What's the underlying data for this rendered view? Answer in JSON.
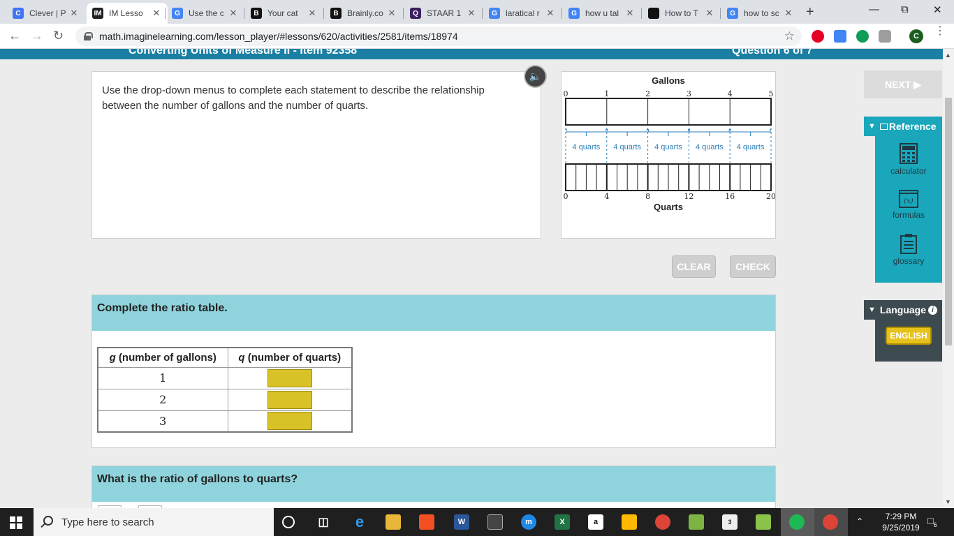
{
  "browser": {
    "tabs": [
      {
        "label": "Clever | P",
        "favicon": "C",
        "color": "#4274f6"
      },
      {
        "label": "IM Lesso",
        "favicon": "IM",
        "color": "#202124"
      },
      {
        "label": "Use the c",
        "favicon": "G",
        "color": "#4285f4"
      },
      {
        "label": "Your cat",
        "favicon": "B",
        "color": "#111111"
      },
      {
        "label": "Brainly.co",
        "favicon": "B",
        "color": "#111111"
      },
      {
        "label": "STAAR 1",
        "favicon": "Q",
        "color": "#3c1f5e"
      },
      {
        "label": "laratical r",
        "favicon": "G",
        "color": "#4285f4"
      },
      {
        "label": "how u tal",
        "favicon": "G",
        "color": "#4285f4"
      },
      {
        "label": "How to T",
        "favicon": "HTG",
        "color": "#111111"
      },
      {
        "label": "how to sc",
        "favicon": "G",
        "color": "#4285f4"
      }
    ],
    "url": "math.imaginelearning.com/lesson_player/#lessons/620/activities/2581/items/18974",
    "profile_initial": "C"
  },
  "lesson": {
    "title": "Converting Units of Measure II - Item 92358",
    "question_counter": "Question 6 of 7",
    "instructions": "Use the drop-down menus to complete each statement to describe the relationship between the number of gallons and the number of quarts.",
    "next_label": "NEXT ▶",
    "clear_label": "CLEAR",
    "check_label": "CHECK"
  },
  "diagram": {
    "top_label": "Gallons",
    "bottom_label": "Quarts",
    "gallon_ticks": [
      "0",
      "1",
      "2",
      "3",
      "4",
      "5"
    ],
    "quart_ticks": [
      "0",
      "4",
      "8",
      "12",
      "16",
      "20"
    ],
    "group_labels": [
      "4 quarts",
      "4 quarts",
      "4 quarts",
      "4 quarts",
      "4 quarts"
    ]
  },
  "ratio_section": {
    "heading": "Complete the ratio table.",
    "col1_var": "g",
    "col1_text": " (number of gallons)",
    "col2_var": "q",
    "col2_text": " (number of quarts)",
    "rows": [
      {
        "g": "1"
      },
      {
        "g": "2"
      },
      {
        "g": "3"
      }
    ]
  },
  "ratio_question": {
    "heading": "What is the ratio of gallons to quarts?"
  },
  "reference": {
    "tab_label": "Reference",
    "items": [
      {
        "label": "calculator",
        "icon": "calculator-icon"
      },
      {
        "label": "formulas",
        "icon": "formulas-icon"
      },
      {
        "label": "glossary",
        "icon": "glossary-icon"
      }
    ],
    "formula_symbol": "(x)"
  },
  "language": {
    "tab_label": "Language",
    "english_label": "ENGLISH"
  },
  "taskbar": {
    "search_placeholder": "Type here to search",
    "time": "7:29 PM",
    "date": "9/25/2019",
    "notification_count": "6",
    "mail_count": "3"
  },
  "colors": {
    "header_blue": "#1a7fa3",
    "section_teal": "#8fd3dc",
    "reference_teal": "#1aa6bb",
    "answer_yellow": "#d9c227",
    "diagram_blue": "#2a7fb8"
  }
}
